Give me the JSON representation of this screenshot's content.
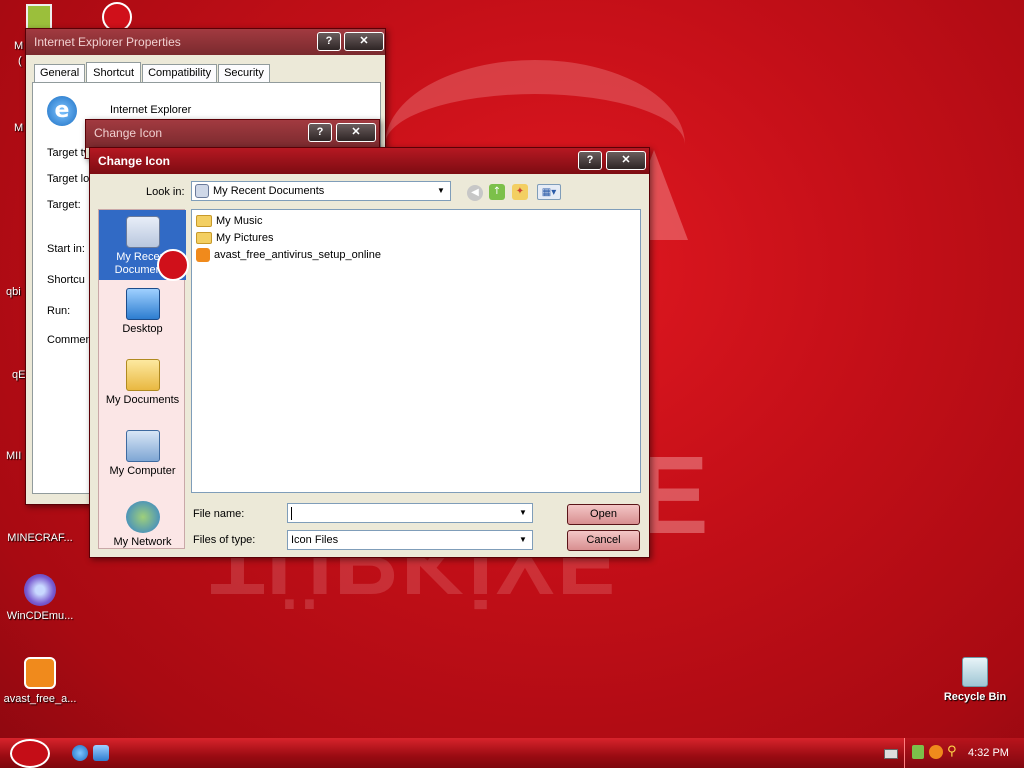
{
  "desktop": {
    "left_fragments": [
      "M",
      "(",
      "M",
      "qbi",
      "qE",
      "MII"
    ],
    "icons": [
      {
        "label": "MINECRAF..."
      },
      {
        "label": "WinCDEmu..."
      },
      {
        "label": "avast_free_a..."
      },
      {
        "label": "Recycle Bin"
      }
    ],
    "wallpaper_text": "TÜRKİYE"
  },
  "ie_properties": {
    "title": "Internet Explorer Properties",
    "help_btn": "?",
    "close_btn": "✕",
    "tabs": [
      "General",
      "Shortcut",
      "Compatibility",
      "Security"
    ],
    "active_tab": "Shortcut",
    "app_name": "Internet Explorer",
    "field_labels": [
      "Target ty",
      "Target lo",
      "Target:",
      "Start in:",
      "Shortcu",
      "Run:",
      "Commen"
    ]
  },
  "change_icon_back": {
    "title": "Change Icon",
    "help_btn": "?",
    "close_btn": "✕"
  },
  "change_icon": {
    "title": "Change Icon",
    "help_btn": "?",
    "close_btn": "✕",
    "look_in_label": "Look in:",
    "look_in_value": "My Recent Documents",
    "places": [
      {
        "label": "My Recent Documents",
        "icon": "recent-documents-icon",
        "selected": true
      },
      {
        "label": "Desktop",
        "icon": "desktop-icon"
      },
      {
        "label": "My Documents",
        "icon": "my-documents-icon"
      },
      {
        "label": "My Computer",
        "icon": "my-computer-icon"
      },
      {
        "label": "My Network",
        "icon": "my-network-icon"
      }
    ],
    "files": [
      {
        "name": "My Music",
        "icon": "folder-icon"
      },
      {
        "name": "My Pictures",
        "icon": "folder-icon"
      },
      {
        "name": "avast_free_antivirus_setup_online",
        "icon": "avast-icon"
      }
    ],
    "file_name_label": "File name:",
    "file_name_value": "",
    "files_of_type_label": "Files of type:",
    "files_of_type_value": "Icon Files",
    "open_btn": "Open",
    "cancel_btn": "Cancel"
  },
  "taskbar": {
    "time": "4:32 PM"
  }
}
